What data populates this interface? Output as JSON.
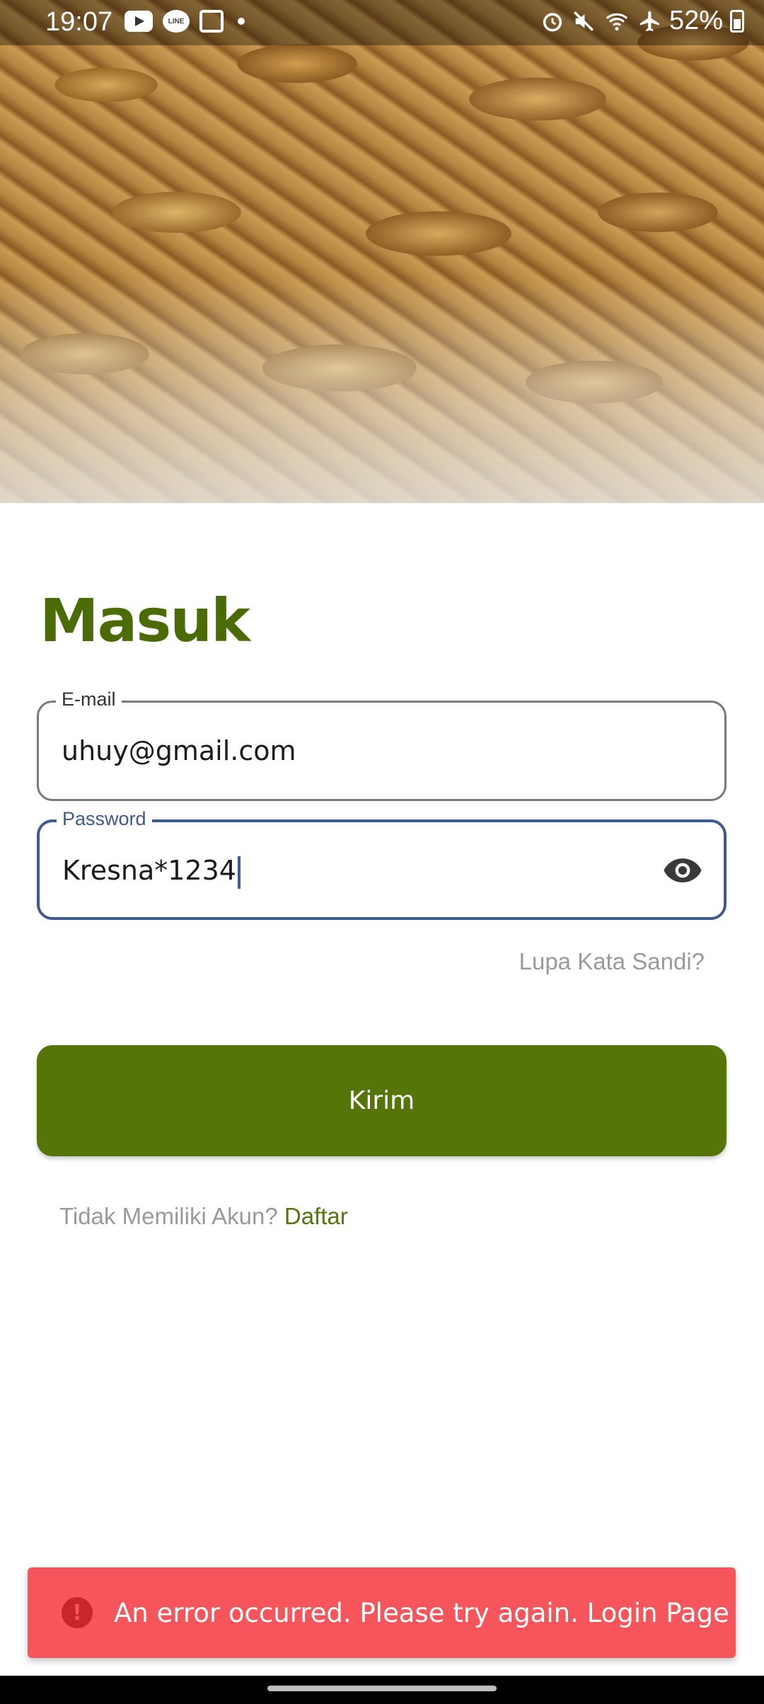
{
  "status_bar": {
    "time": "19:07",
    "battery": "52%",
    "left_icons": [
      "youtube-icon",
      "line-icon",
      "gallery-icon",
      "dot-icon"
    ],
    "right_icons": [
      "alarm-icon",
      "mute-icon",
      "wifi-icon",
      "airplane-icon",
      "battery-icon"
    ]
  },
  "page": {
    "title": "Masuk"
  },
  "form": {
    "email": {
      "label": "E-mail",
      "value": "uhuy@gmail.com"
    },
    "password": {
      "label": "Password",
      "value": "Kresna*1234"
    },
    "forgot_link": "Lupa Kata Sandi?",
    "submit_label": "Kirim",
    "signup_prompt": "Tidak Memiliki Akun?",
    "signup_link": "Daftar"
  },
  "toast": {
    "icon": "error-icon",
    "message": "An error occurred. Please try again. Login Page"
  },
  "colors": {
    "brand_green": "#557508",
    "title_green": "#4a6b06",
    "focus_blue": "#3f5a8f",
    "error_red": "#f7555c"
  }
}
